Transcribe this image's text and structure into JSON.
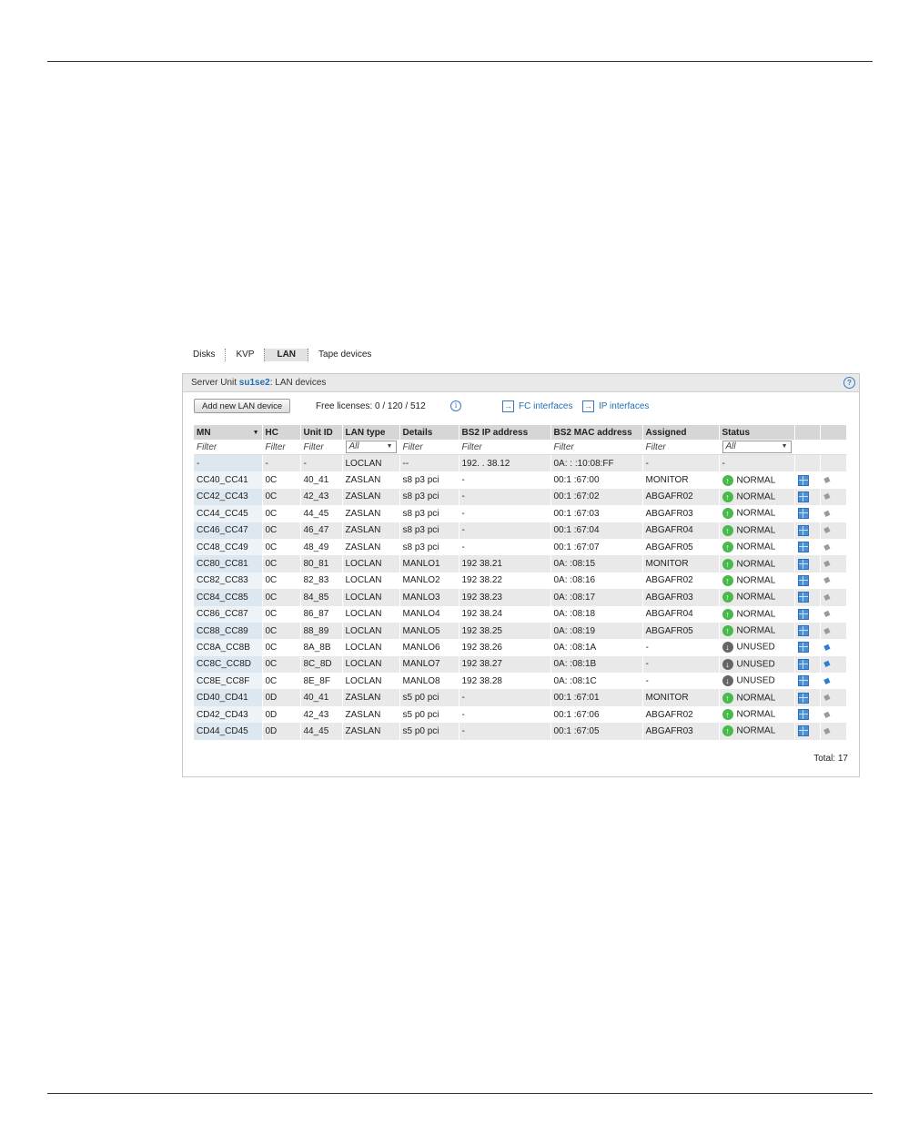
{
  "tabs": [
    {
      "label": "Disks"
    },
    {
      "label": "KVP"
    },
    {
      "label": "LAN"
    },
    {
      "label": "Tape devices"
    }
  ],
  "panel": {
    "title_prefix": "Server Unit ",
    "unit_name": "su1se2",
    "title_suffix": ": LAN devices",
    "help": "?"
  },
  "toolbar": {
    "add_button": "Add new LAN device",
    "licenses_text": "Free licenses:  0  /  120  /  512",
    "info": "i",
    "fc_link": "FC interfaces",
    "ip_link": "IP interfaces"
  },
  "columns": [
    "MN",
    "HC",
    "Unit ID",
    "LAN type",
    "Details",
    "BS2 IP address",
    "BS2 MAC address",
    "Assigned",
    "Status"
  ],
  "filters": {
    "text": "Filter",
    "lan_type": "All",
    "status": "All"
  },
  "rows": [
    {
      "mn": "-",
      "hc": "-",
      "uid": "-",
      "lan": "LOCLAN",
      "det": "--",
      "ip": "192.   .  38.12",
      "mac": "0A:  :  :10:08:FF",
      "asg": "-",
      "st": "-",
      "kind": "none"
    },
    {
      "mn": "CC40_CC41",
      "hc": "0C",
      "uid": "40_41",
      "lan": "ZASLAN",
      "det": "s8 p3 pci",
      "ip": "-",
      "mac": "00:1     :67:00",
      "asg": "MONITOR",
      "st": "NORMAL",
      "kind": "ok"
    },
    {
      "mn": "CC42_CC43",
      "hc": "0C",
      "uid": "42_43",
      "lan": "ZASLAN",
      "det": "s8 p3 pci",
      "ip": "-",
      "mac": "00:1     :67:02",
      "asg": "ABGAFR02",
      "st": "NORMAL",
      "kind": "ok"
    },
    {
      "mn": "CC44_CC45",
      "hc": "0C",
      "uid": "44_45",
      "lan": "ZASLAN",
      "det": "s8 p3 pci",
      "ip": "-",
      "mac": "00:1     :67:03",
      "asg": "ABGAFR03",
      "st": "NORMAL",
      "kind": "ok"
    },
    {
      "mn": "CC46_CC47",
      "hc": "0C",
      "uid": "46_47",
      "lan": "ZASLAN",
      "det": "s8 p3 pci",
      "ip": "-",
      "mac": "00:1     :67:04",
      "asg": "ABGAFR04",
      "st": "NORMAL",
      "kind": "ok"
    },
    {
      "mn": "CC48_CC49",
      "hc": "0C",
      "uid": "48_49",
      "lan": "ZASLAN",
      "det": "s8 p3 pci",
      "ip": "-",
      "mac": "00:1     :67:07",
      "asg": "ABGAFR05",
      "st": "NORMAL",
      "kind": "ok"
    },
    {
      "mn": "CC80_CC81",
      "hc": "0C",
      "uid": "80_81",
      "lan": "LOCLAN",
      "det": "MANLO1",
      "ip": "192      38.21",
      "mac": "0A:      :08:15",
      "asg": "MONITOR",
      "st": "NORMAL",
      "kind": "ok"
    },
    {
      "mn": "CC82_CC83",
      "hc": "0C",
      "uid": "82_83",
      "lan": "LOCLAN",
      "det": "MANLO2",
      "ip": "192      38.22",
      "mac": "0A:      :08:16",
      "asg": "ABGAFR02",
      "st": "NORMAL",
      "kind": "ok"
    },
    {
      "mn": "CC84_CC85",
      "hc": "0C",
      "uid": "84_85",
      "lan": "LOCLAN",
      "det": "MANLO3",
      "ip": "192      38.23",
      "mac": "0A:      :08:17",
      "asg": "ABGAFR03",
      "st": "NORMAL",
      "kind": "ok"
    },
    {
      "mn": "CC86_CC87",
      "hc": "0C",
      "uid": "86_87",
      "lan": "LOCLAN",
      "det": "MANLO4",
      "ip": "192      38.24",
      "mac": "0A:      :08:18",
      "asg": "ABGAFR04",
      "st": "NORMAL",
      "kind": "ok"
    },
    {
      "mn": "CC88_CC89",
      "hc": "0C",
      "uid": "88_89",
      "lan": "LOCLAN",
      "det": "MANLO5",
      "ip": "192      38.25",
      "mac": "0A:      :08:19",
      "asg": "ABGAFR05",
      "st": "NORMAL",
      "kind": "ok"
    },
    {
      "mn": "CC8A_CC8B",
      "hc": "0C",
      "uid": "8A_8B",
      "lan": "LOCLAN",
      "det": "MANLO6",
      "ip": "192      38.26",
      "mac": "0A:      :08:1A",
      "asg": "-",
      "st": "UNUSED",
      "kind": "un"
    },
    {
      "mn": "CC8C_CC8D",
      "hc": "0C",
      "uid": "8C_8D",
      "lan": "LOCLAN",
      "det": "MANLO7",
      "ip": "192      38.27",
      "mac": "0A:      :08:1B",
      "asg": "-",
      "st": "UNUSED",
      "kind": "un"
    },
    {
      "mn": "CC8E_CC8F",
      "hc": "0C",
      "uid": "8E_8F",
      "lan": "LOCLAN",
      "det": "MANLO8",
      "ip": "192      38.28",
      "mac": "0A:      :08:1C",
      "asg": "-",
      "st": "UNUSED",
      "kind": "un"
    },
    {
      "mn": "CD40_CD41",
      "hc": "0D",
      "uid": "40_41",
      "lan": "ZASLAN",
      "det": "s5 p0 pci",
      "ip": "-",
      "mac": "00:1     :67:01",
      "asg": "MONITOR",
      "st": "NORMAL",
      "kind": "ok"
    },
    {
      "mn": "CD42_CD43",
      "hc": "0D",
      "uid": "42_43",
      "lan": "ZASLAN",
      "det": "s5 p0 pci",
      "ip": "-",
      "mac": "00:1     :67:06",
      "asg": "ABGAFR02",
      "st": "NORMAL",
      "kind": "ok"
    },
    {
      "mn": "CD44_CD45",
      "hc": "0D",
      "uid": "44_45",
      "lan": "ZASLAN",
      "det": "s5 p0 pci",
      "ip": "-",
      "mac": "00:1     :67:05",
      "asg": "ABGAFR03",
      "st": "NORMAL",
      "kind": "ok"
    }
  ],
  "total": "Total: 17",
  "icons": {
    "status_ok": "arrow-up-circle-icon",
    "status_unused": "arrow-down-circle-icon",
    "detail": "grid-icon",
    "edit": "pencil-icon"
  },
  "colors": {
    "link": "#1f6fb5",
    "ok": "#48b94a",
    "unused": "#666666",
    "header_bg": "#e9e9e9"
  }
}
